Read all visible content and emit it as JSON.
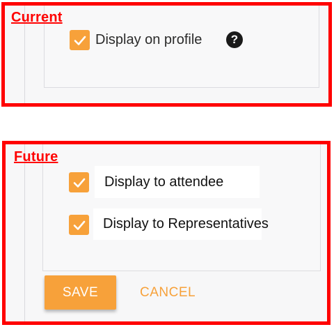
{
  "colors": {
    "annotation_red": "#ff0000",
    "accent_orange": "#f7a13a",
    "panel_bg": "#f7f7f8"
  },
  "current": {
    "label": "Current",
    "options": [
      {
        "label": "Display on profile",
        "checked": true,
        "help_icon": "question-circle-icon"
      }
    ]
  },
  "future": {
    "label": "Future",
    "options": [
      {
        "label": "Display to attendee",
        "checked": true
      },
      {
        "label": "Display to Representatives",
        "checked": true
      }
    ],
    "buttons": {
      "save_label": "SAVE",
      "cancel_label": "CANCEL"
    }
  }
}
